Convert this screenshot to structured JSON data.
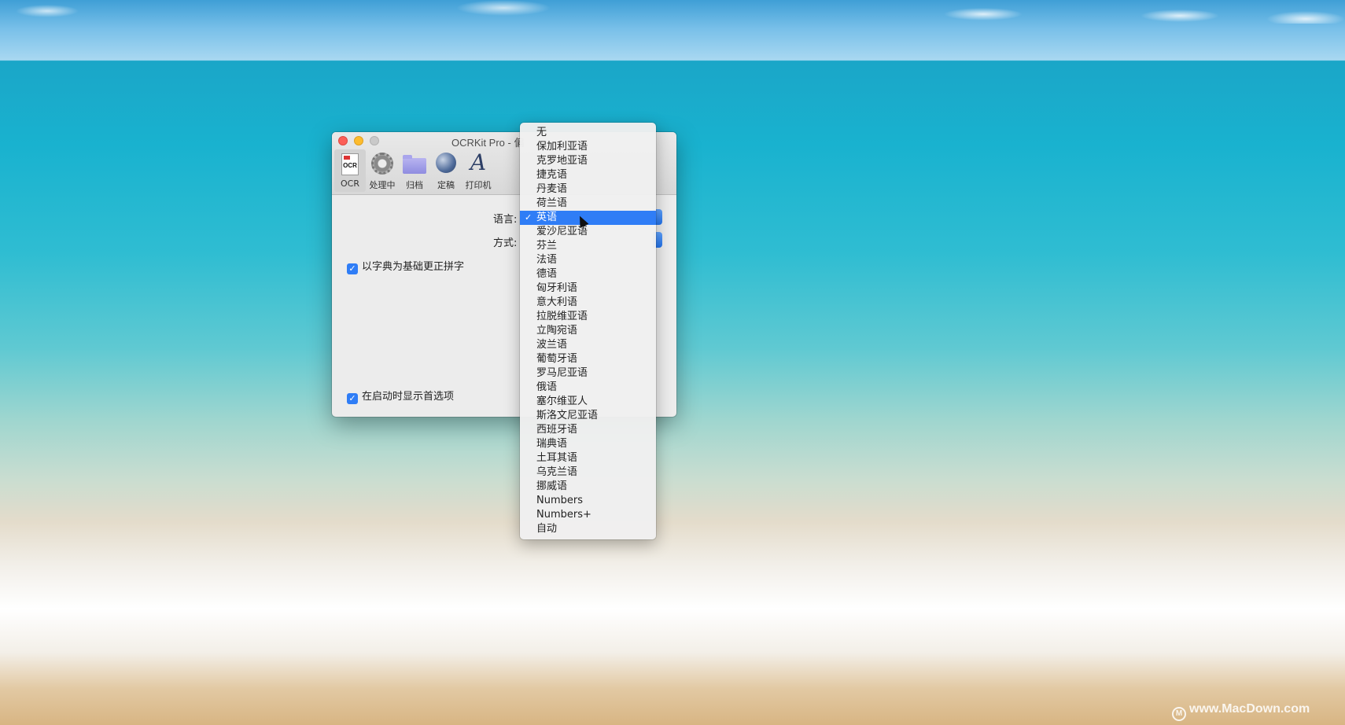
{
  "window": {
    "title": "OCRKit Pro - 偏"
  },
  "toolbar": [
    {
      "label": "OCR",
      "icon": "ocr-document-icon"
    },
    {
      "label": "处理中",
      "icon": "gear-icon"
    },
    {
      "label": "归档",
      "icon": "folder-icon"
    },
    {
      "label": "定稿",
      "icon": "globe-icon"
    },
    {
      "label": "打印机",
      "icon": "letter-a-icon"
    }
  ],
  "form": {
    "language_label": "语言:",
    "method_label": "方式:",
    "spellcheck_label": "以字典为基础更正拼字",
    "spellcheck_checked": true,
    "show_prefs_label": "在启动时显示首选项",
    "show_prefs_checked": true
  },
  "language_menu": {
    "selected": "英语",
    "check_mark": "✓",
    "items": [
      "无",
      "保加利亚语",
      "克罗地亚语",
      "捷克语",
      "丹麦语",
      "荷兰语",
      "英语",
      "爱沙尼亚语",
      "芬兰",
      "法语",
      "德语",
      "匈牙利语",
      "意大利语",
      "拉脱维亚语",
      "立陶宛语",
      "波兰语",
      "葡萄牙语",
      "罗马尼亚语",
      "俄语",
      "塞尔维亚人",
      "斯洛文尼亚语",
      "西班牙语",
      "瑞典语",
      "土耳其语",
      "乌克兰语",
      "挪威语",
      "Numbers",
      "Numbers+",
      "自动"
    ]
  },
  "watermark": {
    "text": "www.MacDown.com",
    "icon": "M"
  },
  "colors": {
    "accent": "#2f7df6",
    "close": "#fc5f57",
    "minimize": "#fdbc2e"
  }
}
